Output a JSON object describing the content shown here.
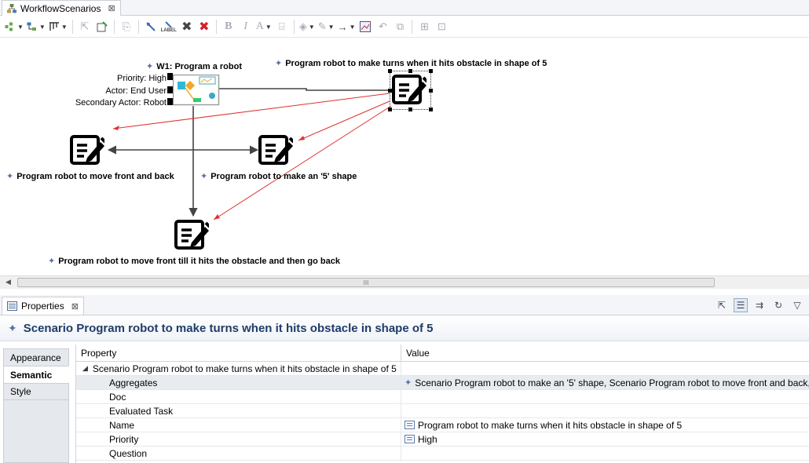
{
  "editor": {
    "tab_title": "WorkflowScenarios",
    "close_glyph": "⊠"
  },
  "toolbar": {
    "label_button": "LABEL",
    "bold": "B",
    "italic": "I",
    "font_color": "A"
  },
  "diagram": {
    "workflow": {
      "title": "W1: Program a robot",
      "priority": "Priority: High",
      "actor": "Actor: End User",
      "secondary_actor": "Secondary Actor: Robot"
    },
    "scenarios": {
      "turns": "Program robot to make turns when it hits obstacle in shape of 5",
      "front_back": "Program robot to move front and back",
      "five_shape": "Program robot to make an '5' shape",
      "till_obstacle": "Program robot to move front till it hits the obstacle and then go back"
    },
    "colors": {
      "connector": "#444444",
      "aggregate_link": "#e03030",
      "icon": "#000000"
    }
  },
  "scrollbar": {
    "thumb_grip": "III"
  },
  "properties": {
    "tab_title": "Properties",
    "close_glyph": "⊠",
    "header_title": "Scenario Program robot to make turns when it hits obstacle in shape of 5",
    "side_tabs": [
      "Appearance",
      "Semantic",
      "Style"
    ],
    "active_side_tab": "Semantic",
    "columns": {
      "property": "Property",
      "value": "Value"
    },
    "root_row": "Scenario Program robot to make turns when it hits obstacle in shape of 5",
    "rows": [
      {
        "name": "Aggregates",
        "value": "Scenario Program robot to make an '5' shape, Scenario Program robot to move front and back,",
        "icon": "star-icon"
      },
      {
        "name": "Doc",
        "value": ""
      },
      {
        "name": "Evaluated Task",
        "value": ""
      },
      {
        "name": "Name",
        "value": "Program robot to make turns when it hits obstacle in shape of 5",
        "icon": "text-field-icon"
      },
      {
        "name": "Priority",
        "value": "High",
        "icon": "text-field-icon"
      },
      {
        "name": "Question",
        "value": ""
      }
    ]
  }
}
